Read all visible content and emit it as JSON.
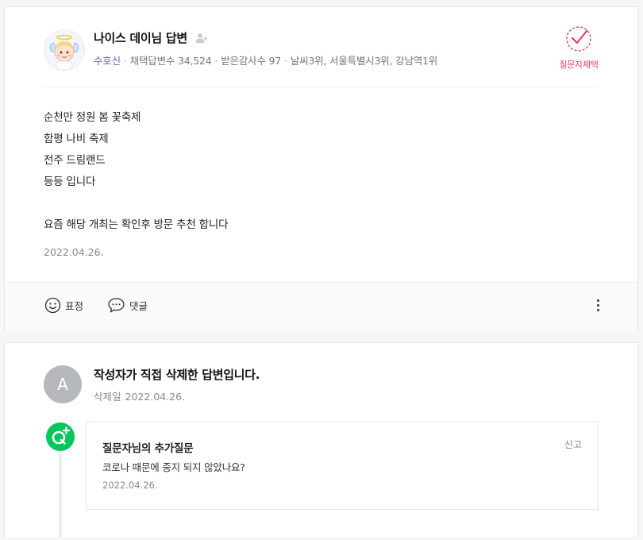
{
  "answer": {
    "author": {
      "name": "나이스 데이님 답변",
      "grade": "수호신",
      "adopted_count": "채택답변수 34,524",
      "thanks_count": "받은감사수 97",
      "rankings": "날씨3위, 서울특별시3위, 강남역1위"
    },
    "adopted_label": "질문자채택",
    "body_lines": [
      "순천만 정원 봄 꽃축제",
      "함평 나비 축제",
      "전주 드림랜드",
      "등등 입니다",
      "",
      "요즘 해당 개최는 확인후 방문 추천 합니다"
    ],
    "date": "2022.04.26.",
    "actions": {
      "emoji_label": "표정",
      "comment_label": "댓글"
    }
  },
  "deleted_answer": {
    "avatar_letter": "A",
    "title": "작성자가 직접 삭제한 답변입니다.",
    "deleted_label": "삭제일",
    "deleted_date": "2022.04.26."
  },
  "followup_question": {
    "title": "질문자님의 추가질문",
    "report_label": "신고",
    "text": "코로나 때문에 중지 되지 않았나요?",
    "date": "2022.04.26."
  },
  "colors": {
    "accent_green": "#03c75a",
    "adopted_red": "#e5415d",
    "grade_blue": "#4a72c8"
  }
}
